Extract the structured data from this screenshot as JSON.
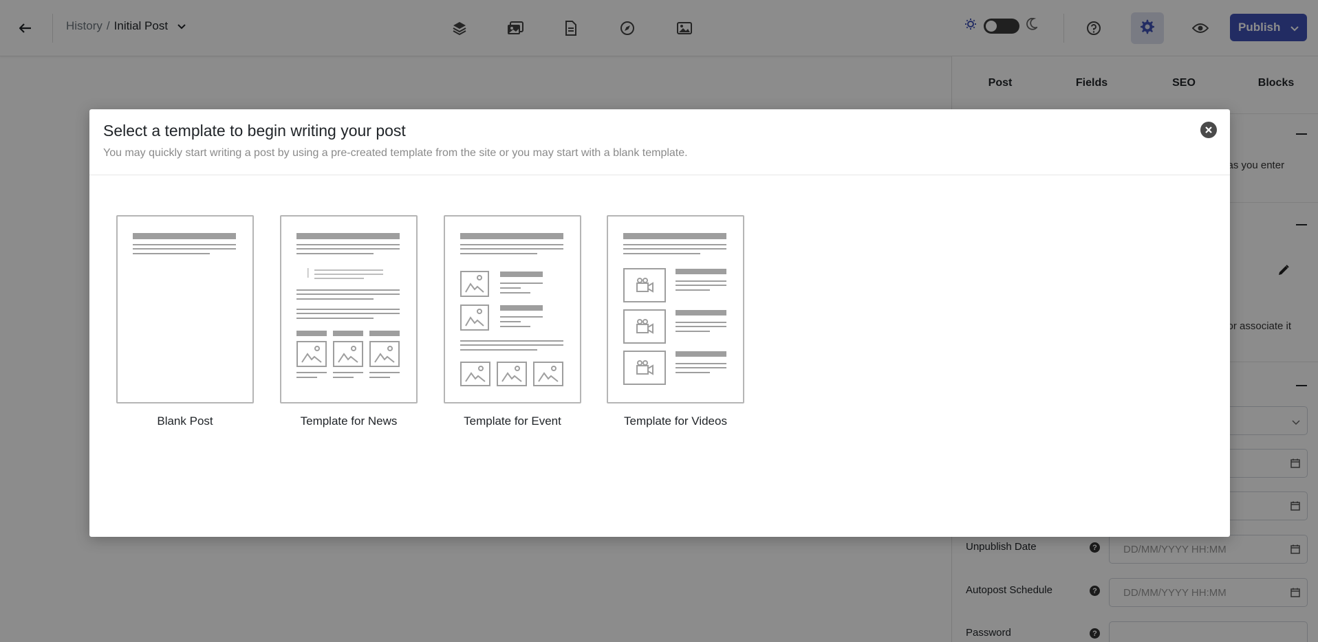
{
  "topbar": {
    "breadcrumb_parent": "History",
    "breadcrumb_separator": "/",
    "breadcrumb_current": "Initial Post",
    "publish_label": "Publish",
    "accent_color": "#3f51b5"
  },
  "sidebar": {
    "tabs": [
      {
        "label": "Post"
      },
      {
        "label": "Fields"
      },
      {
        "label": "SEO"
      },
      {
        "label": "Blocks"
      }
    ],
    "partial_text_1": "n as you enter",
    "partial_text_2": "e or associate it",
    "fields": [
      {
        "label": "Unpublish Date",
        "placeholder": "DD/MM/YYYY HH:MM"
      },
      {
        "label": "Autopost Schedule",
        "placeholder": "DD/MM/YYYY HH:MM"
      },
      {
        "label": "Password",
        "placeholder": ""
      }
    ]
  },
  "modal": {
    "title": "Select a template to begin writing your post",
    "subtitle": "You may quickly start writing a post by using a pre-created template from the site or you may start with a blank template.",
    "templates": [
      {
        "label": "Blank Post",
        "icon": "blank-template-icon"
      },
      {
        "label": "Template for News",
        "icon": "news-template-icon"
      },
      {
        "label": "Template for Event",
        "icon": "event-template-icon"
      },
      {
        "label": "Template for Videos",
        "icon": "videos-template-icon"
      }
    ]
  }
}
